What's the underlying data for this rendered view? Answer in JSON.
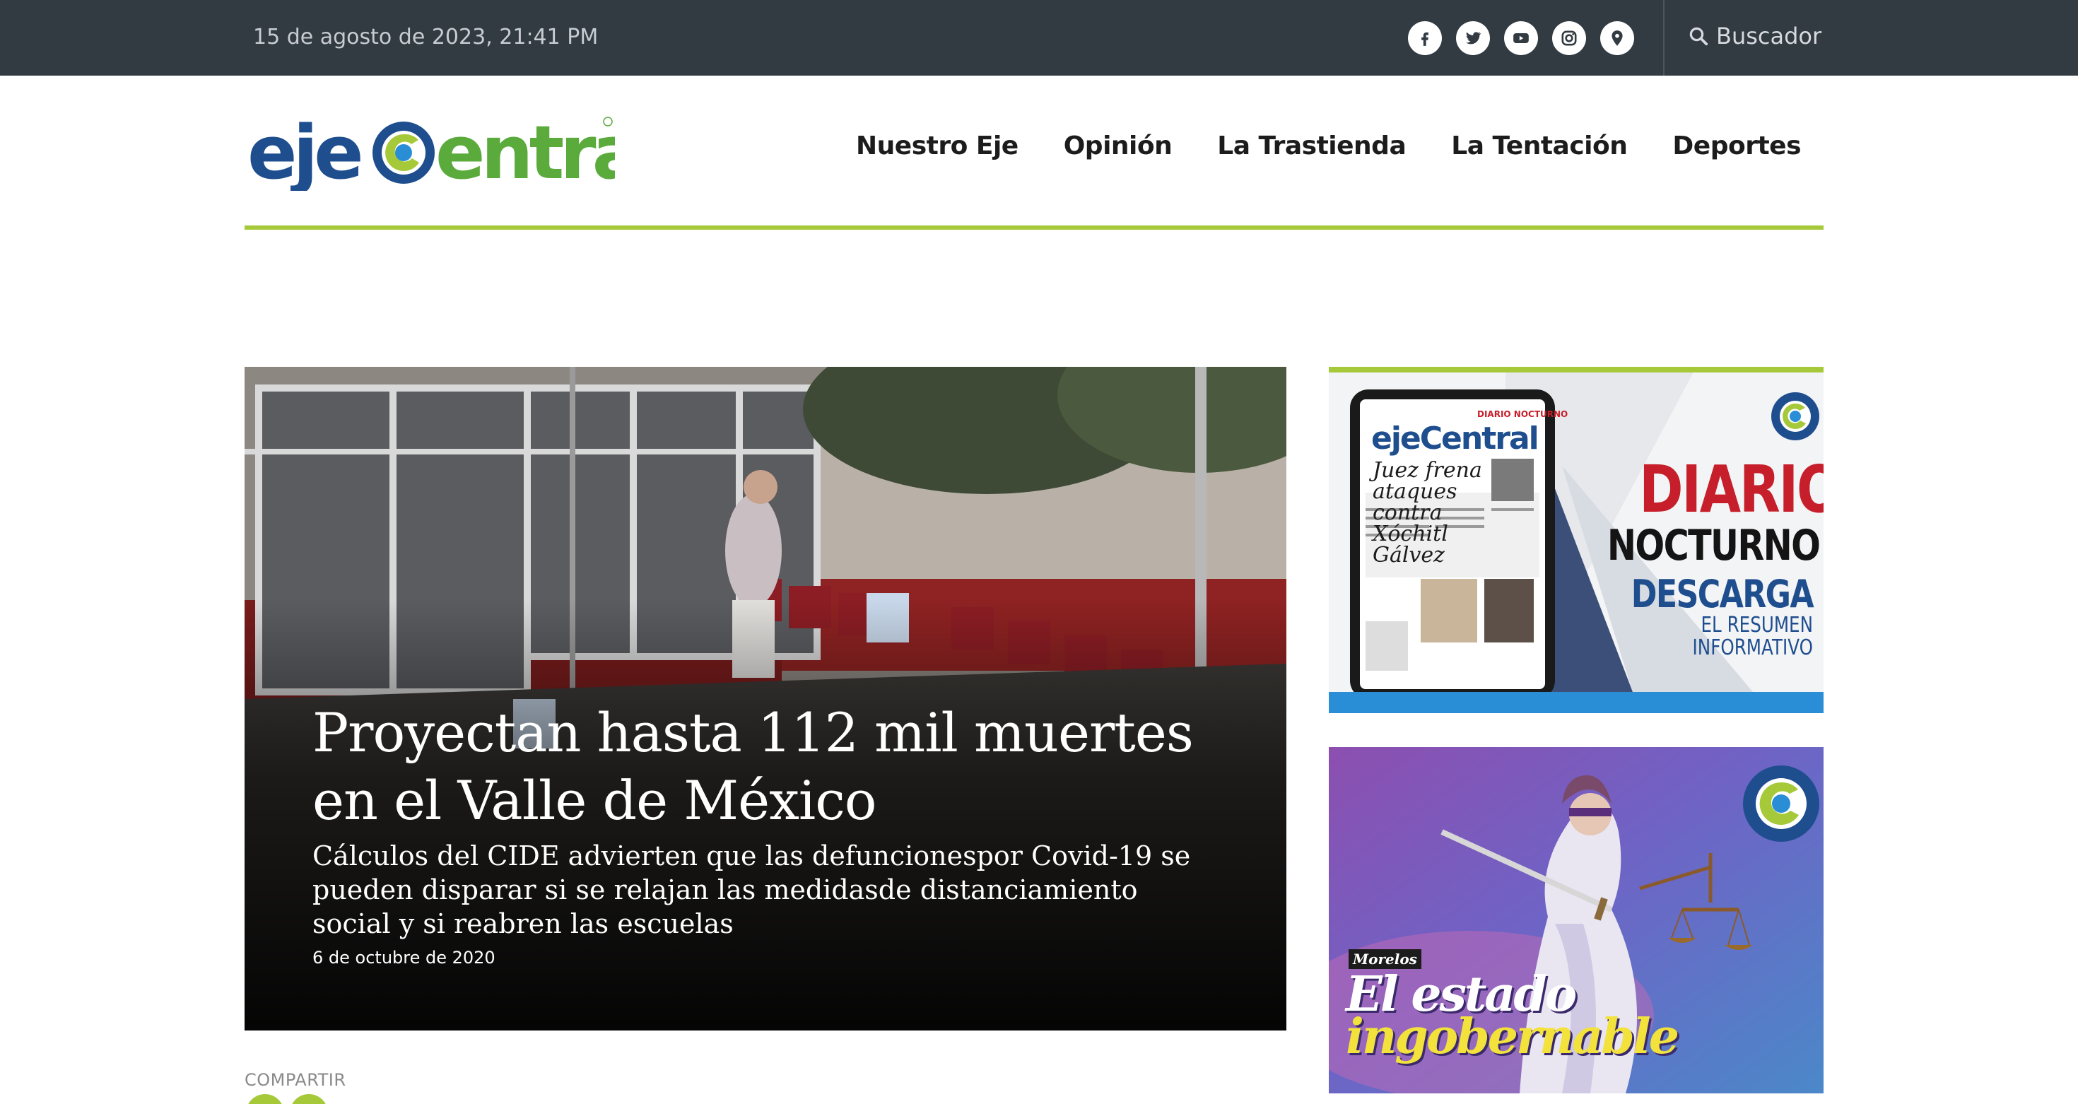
{
  "topbar": {
    "datetime": "15 de agosto de 2023, 21:41 PM",
    "social_icons": [
      "facebook-icon",
      "twitter-icon",
      "youtube-icon",
      "instagram-icon",
      "location-pin-icon"
    ],
    "search_label": "Buscador"
  },
  "header": {
    "logo_text": "ejeCentral",
    "nav": [
      "Nuestro Eje",
      "Opinión",
      "La Trastienda",
      "La Tentación",
      "Deportes"
    ]
  },
  "colors": {
    "topbar_bg": "#323a42",
    "accent_green": "#a6c93a",
    "brand_blue": "#1f4e8f",
    "brand_red": "#c61e2a"
  },
  "hero": {
    "title": "Proyectan hasta 112 mil muertes en el Valle de México",
    "subtitle": "Cálculos del CIDE advierten que las defuncionespor Covid-19 se pueden disparar si se relajan las medidasde distanciamiento social y si reabren las escuelas",
    "date": "6 de octubre de 2020"
  },
  "share": {
    "label": "COMPARTIR"
  },
  "ads": {
    "diario": {
      "line1": "DIARIO",
      "line2": "NOCTURNO",
      "line3": "DESCARGA",
      "line4a": "EL RESUMEN",
      "line4b": "INFORMATIVO",
      "tablet_logo": "ejeCentral",
      "tablet_kicker": "DIARIO NOCTURNO",
      "tablet_headline": "Juez frena ataques contra Xóchitl Gálvez"
    },
    "morelos": {
      "tag": "Morelos",
      "line1": "El estado",
      "line2": "ingobernable"
    }
  }
}
